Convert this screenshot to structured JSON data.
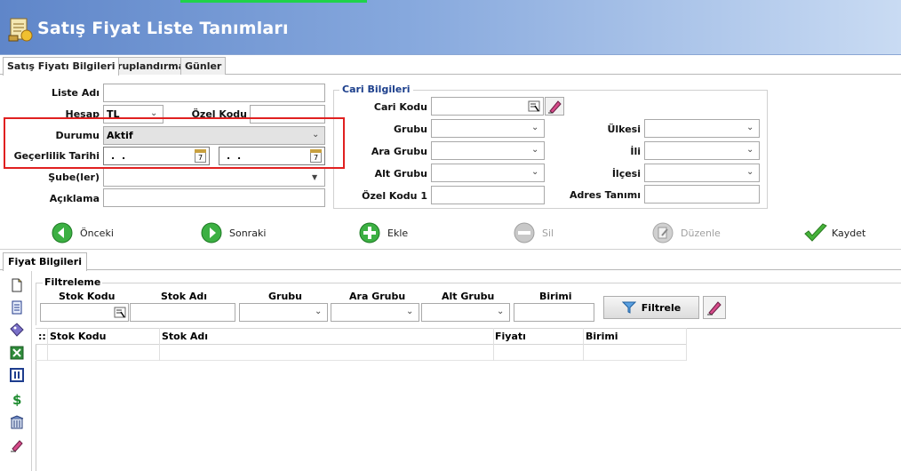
{
  "window": {
    "title": "Satış Fiyat Liste Tanımları"
  },
  "tabs": [
    {
      "label": "Satış Fiyatı Bilgileri",
      "active": true
    },
    {
      "label": "Gruplandırma",
      "active": false
    },
    {
      "label": "Günler",
      "active": false
    }
  ],
  "form": {
    "liste_adi": {
      "label": "Liste Adı",
      "value": ""
    },
    "hesap": {
      "label": "Hesap",
      "value": "TL"
    },
    "ozel_kodu": {
      "label": "Özel Kodu",
      "value": ""
    },
    "durumu": {
      "label": "Durumu",
      "value": "Aktif"
    },
    "gecerlilik": {
      "label": "Geçerlilik Tarihi",
      "start": ". .",
      "end": ". ."
    },
    "subeler": {
      "label": "Şube(ler)",
      "value": ""
    },
    "aciklama": {
      "label": "Açıklama",
      "value": ""
    }
  },
  "cari": {
    "title": "Cari Bilgileri",
    "cari_kodu": {
      "label": "Cari Kodu",
      "value": ""
    },
    "grubu": {
      "label": "Grubu",
      "value": ""
    },
    "ara_grubu": {
      "label": "Ara Grubu",
      "value": ""
    },
    "alt_grubu": {
      "label": "Alt Grubu",
      "value": ""
    },
    "ozel_kodu_1": {
      "label": "Özel Kodu 1",
      "value": ""
    },
    "ulkesi": {
      "label": "Ülkesi",
      "value": ""
    },
    "ili": {
      "label": "İli",
      "value": ""
    },
    "ilcesi": {
      "label": "İlçesi",
      "value": ""
    },
    "adres_tanimi": {
      "label": "Adres Tanımı",
      "value": ""
    }
  },
  "toolbar": {
    "onceki": "Önceki",
    "sonraki": "Sonraki",
    "ekle": "Ekle",
    "sil": "Sil",
    "duzenle": "Düzenle",
    "kaydet": "Kaydet"
  },
  "subtab": {
    "label": "Fiyat Bilgileri"
  },
  "filter": {
    "title": "Filtreleme",
    "headers": [
      "Stok Kodu",
      "Stok Adı",
      "Grubu",
      "Ara Grubu",
      "Alt Grubu",
      "Birimi"
    ],
    "button": "Filtrele"
  },
  "grid": {
    "marker": "::",
    "columns": [
      "Stok Kodu",
      "Stok Adı",
      "Fiyatı",
      "Birimi"
    ]
  },
  "colors": {
    "accent": "#5f86c9",
    "highlight": "#e02020"
  }
}
